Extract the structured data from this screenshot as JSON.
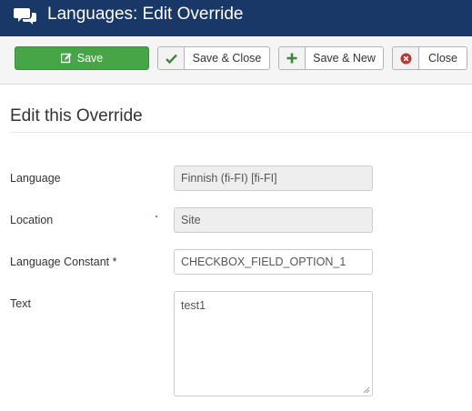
{
  "header": {
    "title": "Languages: Edit Override",
    "icon": "comments-icon"
  },
  "toolbar": {
    "save_label": "Save",
    "save_close_label": "Save & Close",
    "save_new_label": "Save & New",
    "close_label": "Close"
  },
  "form": {
    "section_title": "Edit this Override",
    "language": {
      "label": "Language",
      "value": "Finnish (fi-FI) [fi-FI]"
    },
    "location": {
      "label": "Location",
      "value": "Site"
    },
    "constant": {
      "label": "Language Constant *",
      "value": "CHECKBOX_FIELD_OPTION_1"
    },
    "text": {
      "label": "Text",
      "value": "test1"
    }
  },
  "colors": {
    "header_bg": "#1a3867",
    "save_green": "#46a546",
    "toolbar_bg": "#f5f5f5",
    "close_red": "#bd362f"
  }
}
